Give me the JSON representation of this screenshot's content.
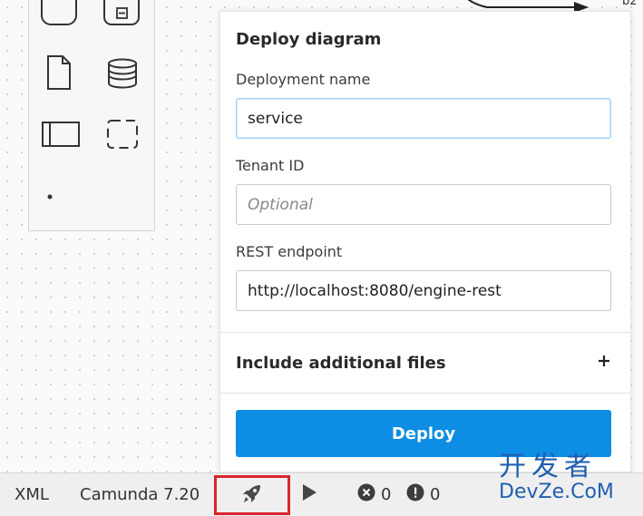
{
  "popup": {
    "title": "Deploy diagram",
    "deployment_name_label": "Deployment name",
    "deployment_name_value": "service",
    "tenant_id_label": "Tenant ID",
    "tenant_id_placeholder": "Optional",
    "rest_endpoint_label": "REST endpoint",
    "rest_endpoint_value": "http://localhost:8080/engine-rest",
    "additional_files_label": "Include additional files",
    "deploy_button_label": "Deploy"
  },
  "diagram": {
    "partial_label": "b2"
  },
  "status_bar": {
    "xml_label": "XML",
    "engine_label": "Camunda 7.20",
    "error_count": "0",
    "warning_count": "0"
  },
  "watermark": {
    "line1": "开发者",
    "line2": "DevZe.CoM"
  },
  "colors": {
    "accent": "#0d8de4",
    "highlight_box": "#d9252a",
    "status_bar_bg": "#efefef"
  },
  "icons": [
    "rounded-rect-icon",
    "subprocess-icon",
    "data-object-icon",
    "data-store-icon",
    "pool-icon",
    "group-icon",
    "rocket-icon",
    "play-icon",
    "error-icon",
    "warning-icon",
    "plus-icon"
  ]
}
